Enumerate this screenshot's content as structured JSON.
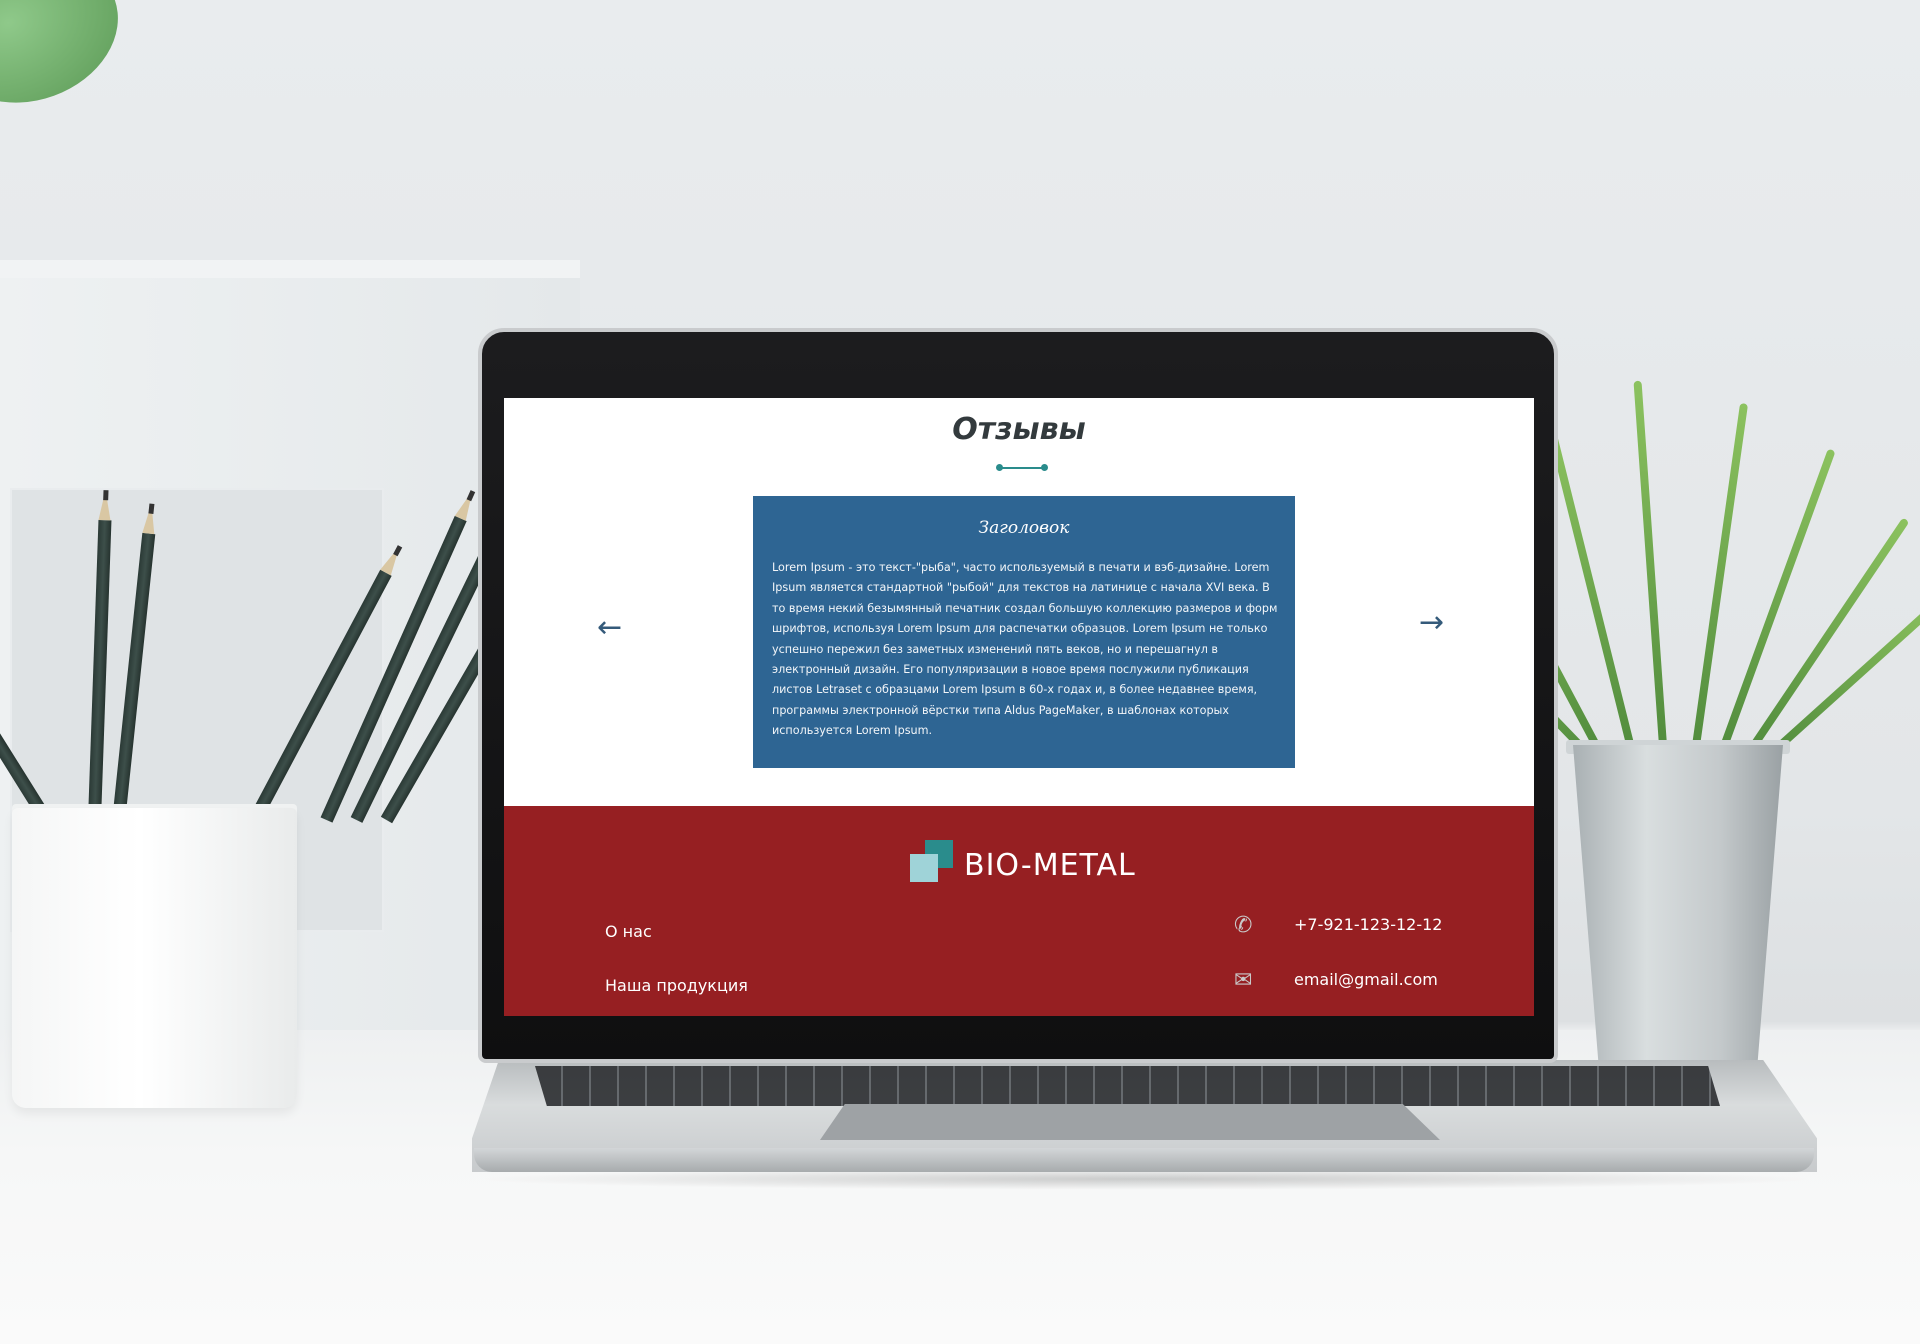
{
  "reviews": {
    "section_title": "Отзывы",
    "card_title": "Заголовок",
    "card_text": "Lorem Ipsum - это текст-\"рыба\", часто используемый в печати и вэб-дизайне. Lorem Ipsum является стандартной \"рыбой\" для текстов на латинице с начала XVI века. В то время некий безымянный печатник создал большую коллекцию размеров и форм шрифтов, используя Lorem Ipsum для распечатки образцов. Lorem Ipsum не только успешно пережил без заметных изменений пять веков, но и перешагнул в электронный дизайн. Его популяризации в новое время послужили публикация листов Letraset с образцами Lorem Ipsum в 60-х годах и, в более недавнее время, программы электронной вёрстки типа Aldus PageMaker, в шаблонах которых используется Lorem Ipsum.",
    "prev_arrow": "←",
    "next_arrow": "→"
  },
  "footer": {
    "brand": "BIO-METAL",
    "nav": [
      "О нас",
      "Наша продукция"
    ],
    "phone": "+7-921-123-12-12",
    "email": "email@gmail.com",
    "phone_icon": "phone-icon",
    "email_icon": "envelope-icon"
  },
  "colors": {
    "card_bg": "#2e6593",
    "footer_bg": "#961f22",
    "accent": "#2a8c8c",
    "logo_light": "#9fd3d8"
  }
}
